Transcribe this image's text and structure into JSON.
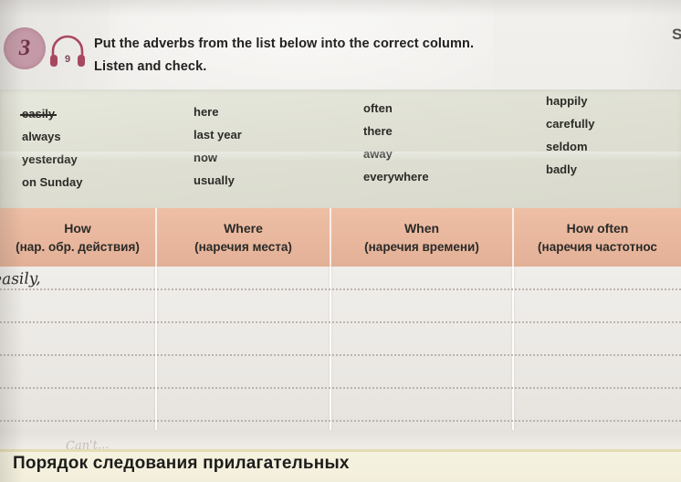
{
  "exercise": {
    "number": "3",
    "audio_track": "9",
    "instruction_line1": "Put the adverbs from the list below into the correct column.",
    "instruction_line2": "Listen and check."
  },
  "edge": {
    "cut_off_letter": "S"
  },
  "word_bank": {
    "columns": [
      {
        "words": [
          "easily",
          "always",
          "yesterday",
          "on Sunday"
        ],
        "struck": [
          true,
          false,
          false,
          false
        ]
      },
      {
        "words": [
          "here",
          "last year",
          "now",
          "usually"
        ],
        "struck": [
          false,
          false,
          false,
          false
        ]
      },
      {
        "words": [
          "often",
          "there",
          "away",
          "everywhere"
        ],
        "struck": [
          false,
          false,
          false,
          false
        ]
      },
      {
        "words": [
          "happily",
          "carefully",
          "seldom",
          "badly"
        ],
        "struck": [
          false,
          false,
          false,
          false
        ]
      }
    ]
  },
  "table": {
    "headers": [
      {
        "en": "How",
        "ru": "(нар. обр. действия)"
      },
      {
        "en": "Where",
        "ru": "(наречия места)"
      },
      {
        "en": "When",
        "ru": "(наречия времени)"
      },
      {
        "en": "How often",
        "ru": "(наречия частотнос"
      }
    ],
    "handwritten_answer": "easily,",
    "row_count": 5
  },
  "bottom_section": {
    "title": "Порядок следования прилагательных",
    "pencil_note": "Can't..."
  },
  "colors": {
    "circle": "#c59aa8",
    "circle_text": "#6e3347",
    "headphones": "#a8485e",
    "word_bank_bg": "#dfe0d3",
    "table_header_bg": "#e8b79d",
    "table_body_bg": "#eae7e3",
    "bottom_band_bg": "#f4f0dd",
    "dotted_line": "#b3aba6"
  }
}
